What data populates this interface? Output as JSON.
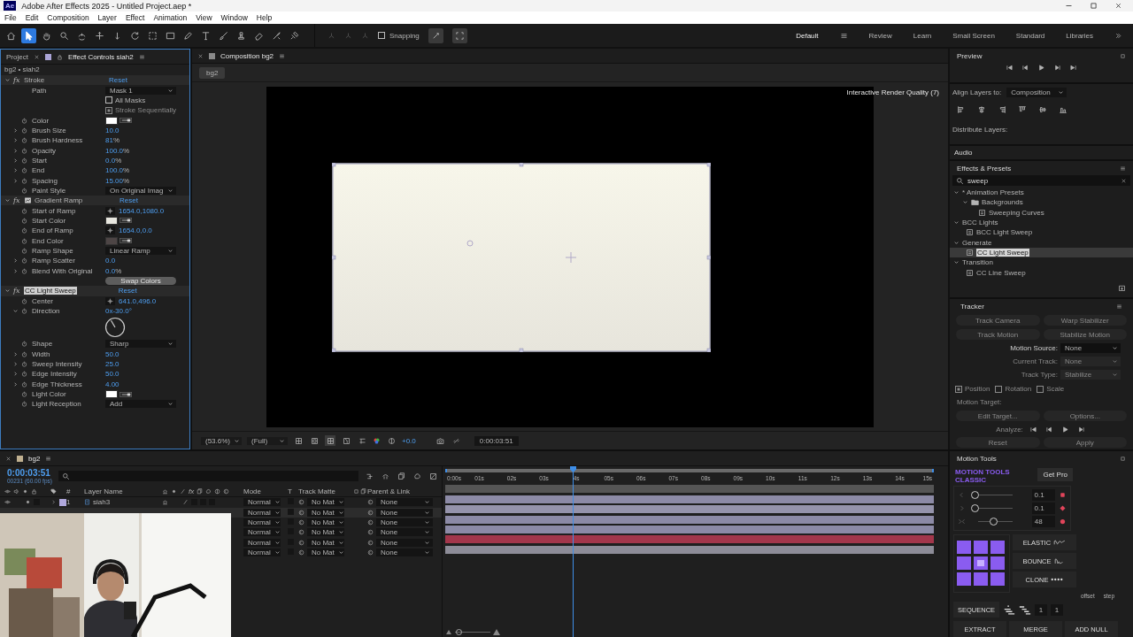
{
  "window": {
    "app_icon": "Ae",
    "title": "Adobe After Effects 2025 - Untitled Project.aep *"
  },
  "menu": [
    "File",
    "Edit",
    "Composition",
    "Layer",
    "Effect",
    "Animation",
    "View",
    "Window",
    "Help"
  ],
  "toolbar": {
    "tools": [
      {
        "kind": "home",
        "selected": false
      },
      {
        "kind": "pointer",
        "selected": true
      },
      {
        "kind": "hand",
        "selected": false
      },
      {
        "kind": "zoom",
        "selected": false
      },
      {
        "kind": "orbit",
        "selected": false
      },
      {
        "kind": "move",
        "selected": false
      },
      {
        "kind": "dolly",
        "selected": false
      },
      {
        "kind": "rotate",
        "selected": false
      },
      {
        "kind": "marquee",
        "selected": false
      },
      {
        "kind": "rect",
        "selected": false
      },
      {
        "kind": "pen",
        "selected": false
      },
      {
        "kind": "text",
        "selected": false
      },
      {
        "kind": "brush",
        "selected": false
      },
      {
        "kind": "stamp",
        "selected": false
      },
      {
        "kind": "eraser",
        "selected": false
      },
      {
        "kind": "roto",
        "selected": false
      },
      {
        "kind": "pin",
        "selected": false
      }
    ],
    "snapping": {
      "label": "Snapping",
      "checked": false
    },
    "workspaces": [
      {
        "label": "Default",
        "selected": true
      },
      {
        "label": "Review",
        "selected": false
      },
      {
        "label": "Learn",
        "selected": false
      },
      {
        "label": "Small Screen",
        "selected": false
      },
      {
        "label": "Standard",
        "selected": false
      },
      {
        "label": "Libraries",
        "selected": false
      }
    ]
  },
  "effect_controls": {
    "tabs": [
      {
        "label": "Project",
        "selected": false
      },
      {
        "label": "Effect Controls siah2",
        "selected": true
      }
    ],
    "layer": "bg2 • siah2",
    "effects": [
      {
        "badge": "fx",
        "name": "Stroke",
        "reset": "Reset",
        "selected": false,
        "has_icon": false,
        "expanded": true,
        "properties": [
          {
            "kind": "dropdown",
            "label": "Path",
            "value": "Mask 1",
            "stopwatch": false
          },
          {
            "kind": "checkbox",
            "label": "All Masks",
            "checked": false,
            "disabled": false
          },
          {
            "kind": "checkbox",
            "label": "Stroke Sequentially",
            "checked": true,
            "disabled": true
          },
          {
            "kind": "color",
            "label": "Color",
            "stopwatch": true,
            "color": "#ffffff"
          },
          {
            "kind": "number",
            "label": "Brush Size",
            "stopwatch": true,
            "expanded": false,
            "value": "10.0"
          },
          {
            "kind": "number",
            "label": "Brush Hardness",
            "stopwatch": true,
            "expanded": false,
            "value": "81",
            "unit": "%"
          },
          {
            "kind": "number",
            "label": "Opacity",
            "stopwatch": true,
            "expanded": false,
            "value": "100.0",
            "unit": "%"
          },
          {
            "kind": "number",
            "label": "Start",
            "stopwatch": true,
            "expanded": false,
            "value": "0.0",
            "unit": "%"
          },
          {
            "kind": "number",
            "label": "End",
            "stopwatch": true,
            "expanded": false,
            "value": "100.0",
            "unit": "%"
          },
          {
            "kind": "number",
            "label": "Spacing",
            "stopwatch": true,
            "expanded": false,
            "value": "15.00",
            "unit": "%"
          },
          {
            "kind": "dropdown",
            "label": "Paint Style",
            "stopwatch": true,
            "value": "On Original Imag"
          }
        ]
      },
      {
        "badge": "fx",
        "name": "Gradient Ramp",
        "reset": "Reset",
        "selected": false,
        "has_icon": true,
        "expanded": true,
        "properties": [
          {
            "kind": "point",
            "label": "Start of Ramp",
            "stopwatch": true,
            "value": "1654.0,1080.0"
          },
          {
            "kind": "color",
            "label": "Start Color",
            "stopwatch": true,
            "color": "#e8e7df"
          },
          {
            "kind": "point",
            "label": "End of Ramp",
            "stopwatch": true,
            "value": "1654.0,0.0"
          },
          {
            "kind": "color",
            "label": "End Color",
            "stopwatch": true,
            "color": "#4d4545"
          },
          {
            "kind": "dropdown",
            "label": "Ramp Shape",
            "stopwatch": true,
            "value": "Linear Ramp"
          },
          {
            "kind": "number",
            "label": "Ramp Scatter",
            "stopwatch": true,
            "expanded": false,
            "value": "0.0"
          },
          {
            "kind": "number",
            "label": "Blend With Original",
            "stopwatch": true,
            "expanded": false,
            "value": "0.0",
            "unit": "%"
          },
          {
            "kind": "button",
            "label": "Swap Colors"
          }
        ]
      },
      {
        "badge": "fx",
        "name": "CC Light Sweep",
        "reset": "Reset",
        "selected": true,
        "has_icon": false,
        "expanded": true,
        "properties": [
          {
            "kind": "point",
            "label": "Center",
            "stopwatch": true,
            "value": "641.0,496.0"
          },
          {
            "kind": "angle",
            "label": "Direction",
            "stopwatch": true,
            "expanded": true,
            "value": "0x-30.0°"
          },
          {
            "kind": "dropdown",
            "label": "Shape",
            "stopwatch": true,
            "value": "Sharp"
          },
          {
            "kind": "number",
            "label": "Width",
            "stopwatch": true,
            "expanded": false,
            "value": "50.0"
          },
          {
            "kind": "number",
            "label": "Sweep Intensity",
            "stopwatch": true,
            "expanded": false,
            "value": "25.0"
          },
          {
            "kind": "number",
            "label": "Edge Intensity",
            "stopwatch": true,
            "expanded": false,
            "value": "50.0"
          },
          {
            "kind": "number",
            "label": "Edge Thickness",
            "stopwatch": true,
            "expanded": false,
            "value": "4.00"
          },
          {
            "kind": "color",
            "label": "Light Color",
            "stopwatch": true,
            "color": "#ffffff"
          },
          {
            "kind": "dropdown",
            "label": "Light Reception",
            "stopwatch": true,
            "value": "Add"
          }
        ]
      }
    ]
  },
  "composition": {
    "tab": "Composition bg2",
    "breadcrumb": "bg2",
    "render_quality": "Interactive Render Quality (7)",
    "zoom": "(53.6%)",
    "resolution": "(Full)",
    "exposure": "+0.0",
    "timecode": "0:00:03:51"
  },
  "preview": {
    "title": "Preview"
  },
  "align": {
    "label": "Align Layers to:",
    "value": "Composition",
    "distribute": "Distribute Layers:"
  },
  "audio": {
    "title": "Audio"
  },
  "effects_presets": {
    "title": "Effects & Presets",
    "search": "sweep",
    "tree": [
      {
        "label": "* Animation Presets",
        "expanded": true,
        "selected": false,
        "children": [
          {
            "kind": "folder",
            "label": "Backgrounds",
            "expanded": true,
            "selected": false,
            "children": [
              {
                "kind": "preset",
                "label": "Sweeping Curves",
                "selected": false
              }
            ]
          }
        ]
      },
      {
        "label": "BCC Lights",
        "expanded": true,
        "selected": false,
        "children": [
          {
            "kind": "preset",
            "label": "BCC Light Sweep",
            "selected": false
          }
        ]
      },
      {
        "label": "Generate",
        "expanded": true,
        "selected": false,
        "children": [
          {
            "kind": "preset",
            "label": "CC Light Sweep",
            "selected": true
          }
        ]
      },
      {
        "label": "Transition",
        "expanded": true,
        "selected": false,
        "children": [
          {
            "kind": "preset",
            "label": "CC Line Sweep",
            "selected": false
          }
        ]
      }
    ]
  },
  "tracker": {
    "title": "Tracker",
    "buttons": [
      {
        "label": "Track Camera",
        "disabled": true
      },
      {
        "label": "Warp Stabilizer",
        "disabled": true
      },
      {
        "label": "Track Motion",
        "disabled": true
      },
      {
        "label": "Stabilize Motion",
        "disabled": true
      }
    ],
    "fields": [
      {
        "label": "Motion Source:",
        "value": "None",
        "disabled": false
      },
      {
        "label": "Current Track:",
        "value": "None",
        "disabled": true
      },
      {
        "label": "Track Type:",
        "value": "Stabilize",
        "disabled": true
      }
    ],
    "options": [
      {
        "label": "Position",
        "checked": true
      },
      {
        "label": "Rotation",
        "checked": false
      },
      {
        "label": "Scale",
        "checked": false
      }
    ],
    "motion_target": "Motion Target:",
    "target_buttons": [
      {
        "label": "Edit Target...",
        "disabled": true
      },
      {
        "label": "Options...",
        "disabled": true
      }
    ],
    "analyze": "Analyze:",
    "actions": [
      {
        "label": "Reset",
        "disabled": true
      },
      {
        "label": "Apply",
        "disabled": true
      }
    ]
  },
  "motion_tools": {
    "title": "Motion Tools",
    "logo": [
      "MOTION TOOLS",
      "CLASSIC"
    ],
    "get_pro": "Get Pro",
    "sliders": [
      {
        "kind": "ease_in",
        "level": 0.05,
        "value": "0.1"
      },
      {
        "kind": "ease_out",
        "level": 0.05,
        "value": "0.1"
      },
      {
        "kind": "blend",
        "level": 0.45,
        "value": "48"
      }
    ],
    "actions": [
      {
        "kind": "elastic",
        "label": "ELASTIC"
      },
      {
        "kind": "bounce",
        "label": "BOUNCE"
      },
      {
        "kind": "clone",
        "label": "CLONE"
      }
    ],
    "offset": {
      "label": "offset",
      "value": "1"
    },
    "step": {
      "label": "step",
      "value": "1"
    },
    "sequence": "SEQUENCE",
    "bottom": [
      "EXTRACT",
      "MERGE",
      "ADD NULL"
    ]
  },
  "timeline": {
    "tab": "bg2",
    "current_time": "0:00:03:51",
    "frame_info": "00231 (60.00 fps)",
    "columns": {
      "number": "#",
      "layer_name": "Layer Name",
      "switches": "fx",
      "mode": "Mode",
      "t": "T",
      "track_matte": "Track Matte",
      "parent": "Parent & Link"
    },
    "ruler": [
      "0:00s",
      "01s",
      "02s",
      "03s",
      "4s",
      "05s",
      "06s",
      "07s",
      "08s",
      "09s",
      "10s",
      "11s",
      "12s",
      "13s",
      "14s",
      "15s"
    ],
    "playhead": {
      "level": 0.26
    },
    "zoom_slider": {
      "level": 0.1
    },
    "layers": [
      {
        "number": "1",
        "name": "siah3",
        "label": {
          "color": "#b0a8dc"
        },
        "selected": false,
        "mode": "Normal",
        "matte": "No Mat",
        "parent": "None",
        "color": "#8c8aa6"
      },
      {
        "selected": true,
        "mode": "Normal",
        "matte": "No Mat",
        "parent": "None",
        "color": "#9593ab"
      },
      {
        "selected": false,
        "mode": "Normal",
        "matte": "No Mat",
        "parent": "None",
        "color": "#8c8aa6"
      },
      {
        "selected": false,
        "mode": "Normal",
        "matte": "No Mat",
        "parent": "None",
        "color": "#8c8aa6"
      },
      {
        "selected": false,
        "mode": "Normal",
        "matte": "No Mat",
        "parent": "None",
        "color": "#a3364b"
      },
      {
        "selected": false,
        "mode": "Normal",
        "matte": "No Mat",
        "parent": "None",
        "color": "#8d8c98"
      }
    ]
  }
}
